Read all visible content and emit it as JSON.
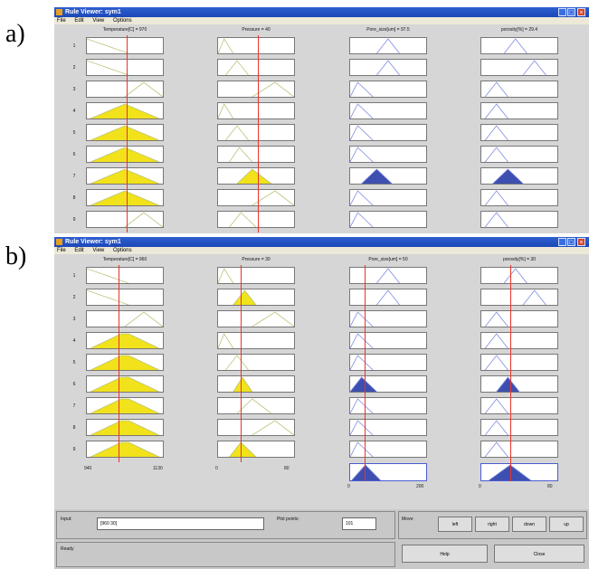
{
  "labels": {
    "a": "a)",
    "b": "b)"
  },
  "colors": {
    "yellow": "#f1e21c",
    "blue": "#3d4fb0",
    "red": "#e8332a",
    "input_line": "#b9c37a",
    "output_line": "#7f8be0"
  },
  "window_a": {
    "title": "Rule Viewer: sym1",
    "menu": [
      "File",
      "Edit",
      "View",
      "Options"
    ],
    "headers": [
      "Temperature[C] = 970",
      "Pressure = 40",
      "Pore_size[um] = 97.5",
      "porosity[%] = 29.4"
    ],
    "rows": [
      "1",
      "2",
      "3",
      "4",
      "5",
      "6",
      "7",
      "8",
      "9"
    ]
  },
  "window_b": {
    "title": "Rule Viewer: sym1",
    "menu": [
      "File",
      "Edit",
      "View",
      "Options"
    ],
    "headers": [
      "Temperature[C] = 960",
      "Pressure = 30",
      "Pore_size[um] = 50",
      "porosity[%] = 30"
    ],
    "rows": [
      "1",
      "2",
      "3",
      "4",
      "5",
      "6",
      "7",
      "8",
      "9"
    ],
    "axis": {
      "temp_min": "940",
      "temp_max": "1130",
      "press_min": "0",
      "press_max": "80",
      "pore_min": "0",
      "pore_max": "200",
      "poro_min": "0",
      "poro_max": "80"
    }
  },
  "bottom": {
    "input_label": "Input:",
    "input_value": "[960 30]",
    "plot_points_label": "Plot points:",
    "plot_points_value": "101",
    "move_label": "Move:",
    "buttons": {
      "left": "left",
      "right": "right",
      "down": "down",
      "up": "up",
      "help": "Help",
      "close": "Close"
    },
    "status": "Ready"
  }
}
